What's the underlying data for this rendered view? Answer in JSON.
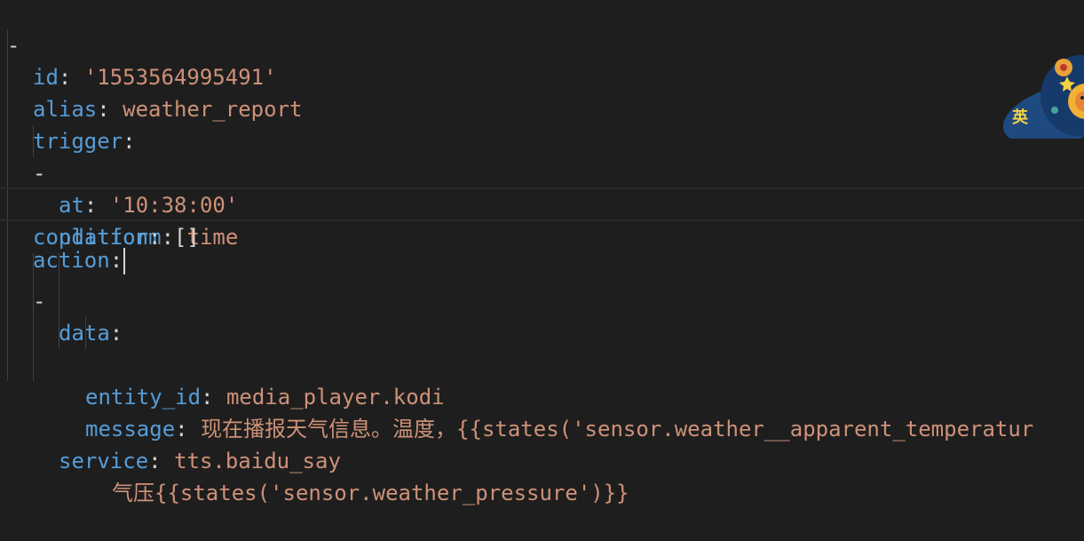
{
  "editor": {
    "lines": [
      {
        "dash": "- ",
        "key": "id",
        "sep": ": ",
        "value": "'1553564995491'"
      },
      {
        "key": "alias",
        "sep": ": ",
        "value": "weather_report"
      },
      {
        "key": "trigger",
        "sep": ":",
        "value": ""
      },
      {
        "dash": "- ",
        "key": "at",
        "sep": ": ",
        "value": "'10:38:00'"
      },
      {
        "key": "platform",
        "sep": ": ",
        "value": "time"
      },
      {
        "key": "condition",
        "sep": ": ",
        "value": "[]"
      },
      {
        "key": "action",
        "sep": ":",
        "value": ""
      },
      {
        "dash": "- ",
        "key": "data",
        "sep": ":",
        "value": ""
      },
      {
        "key": "entity_id",
        "sep": ": ",
        "value": "media_player.kodi"
      },
      {
        "key": "message",
        "sep": ": ",
        "value": "现在播报天气信息。温度，{{states('sensor.weather__apparent_temperatur"
      },
      {
        "key": "",
        "sep": "",
        "value": "气压{{states('sensor.weather_pressure')}}"
      },
      {
        "key": "service",
        "sep": ": ",
        "value": "tts.baidu_say"
      }
    ]
  },
  "ime_badge": {
    "label": "英"
  },
  "colors": {
    "background": "#1e1e1e",
    "key": "#569cd6",
    "string": "#ce9178",
    "punct": "#d4d4d4"
  }
}
